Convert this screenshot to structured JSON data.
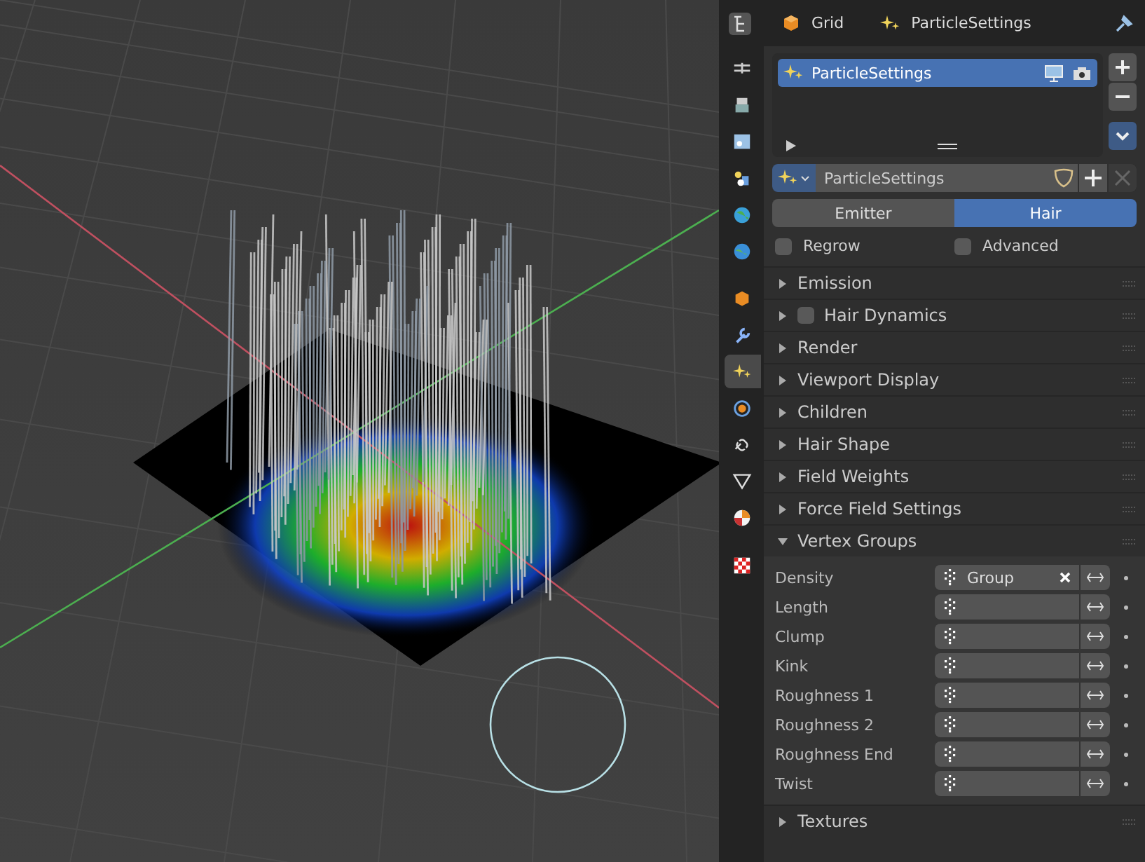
{
  "header": {
    "object": "Grid",
    "data": "ParticleSettings"
  },
  "tabs": [
    {
      "kind": "tool",
      "selected": false
    },
    {
      "kind": "render",
      "selected": false
    },
    {
      "kind": "output",
      "selected": false
    },
    {
      "kind": "view-layer",
      "selected": false
    },
    {
      "kind": "scene",
      "selected": false
    },
    {
      "kind": "world",
      "selected": false
    },
    {
      "kind": "object",
      "selected": false
    },
    {
      "kind": "modifier",
      "selected": false
    },
    {
      "kind": "particles",
      "selected": true
    },
    {
      "kind": "physics",
      "selected": false
    },
    {
      "kind": "constraints",
      "selected": false
    },
    {
      "kind": "data",
      "selected": false
    },
    {
      "kind": "material",
      "selected": false
    },
    {
      "kind": "texture",
      "selected": false
    }
  ],
  "particle_list": {
    "items": [
      {
        "name": "ParticleSettings",
        "selected": true
      }
    ]
  },
  "settings_field": {
    "value": "ParticleSettings"
  },
  "type_toggle": [
    {
      "label": "Emitter",
      "selected": false
    },
    {
      "label": "Hair",
      "selected": true
    }
  ],
  "options": [
    {
      "label": "Regrow",
      "checked": false
    },
    {
      "label": "Advanced",
      "checked": false
    }
  ],
  "panels": [
    {
      "title": "Emission",
      "expanded": false
    },
    {
      "title": "Hair Dynamics",
      "expanded": false,
      "checked": false
    },
    {
      "title": "Render",
      "expanded": false
    },
    {
      "title": "Viewport Display",
      "expanded": false
    },
    {
      "title": "Children",
      "expanded": false
    },
    {
      "title": "Hair Shape",
      "expanded": false
    },
    {
      "title": "Field Weights",
      "expanded": false
    },
    {
      "title": "Force Field Settings",
      "expanded": false
    },
    {
      "title": "Vertex Groups",
      "expanded": true
    }
  ],
  "vertex_groups": [
    {
      "label": "Density",
      "value": "Group"
    },
    {
      "label": "Length"
    },
    {
      "label": "Clump"
    },
    {
      "label": "Kink"
    },
    {
      "label": "Roughness 1"
    },
    {
      "label": "Roughness 2"
    },
    {
      "label": "Roughness End"
    },
    {
      "label": "Twist"
    }
  ],
  "after_panels": [
    {
      "title": "Textures",
      "expanded": false
    }
  ]
}
